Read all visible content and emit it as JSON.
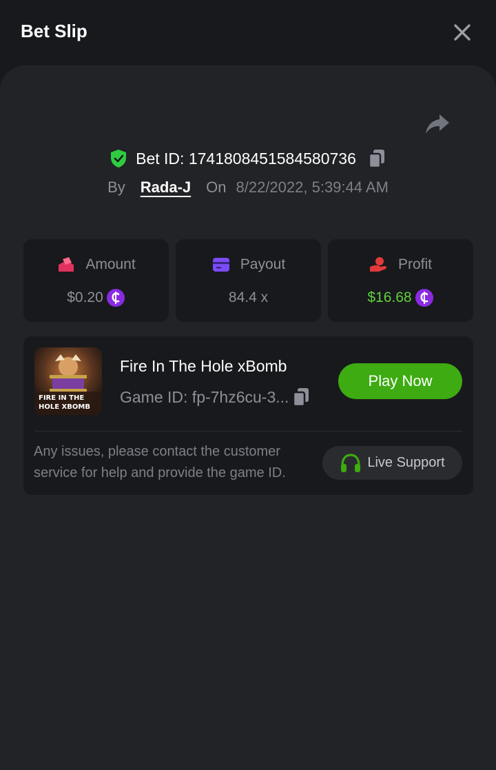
{
  "header": {
    "title": "Bet Slip",
    "close_icon": "close-icon"
  },
  "bet": {
    "id_text": "Bet ID: 1741808451584580736",
    "by_label": "By",
    "user": "Rada-J",
    "on_label": "On",
    "date": "8/22/2022, 5:39:44 AM"
  },
  "stats": [
    {
      "label": "Amount",
      "value": "$0.20",
      "icon": "amount-icon"
    },
    {
      "label": "Payout",
      "value": "84.4 x",
      "icon": "payout-card-icon"
    },
    {
      "label": "Profit",
      "value": "$16.68",
      "icon": "profit-hand-icon"
    }
  ],
  "game": {
    "title": "Fire In The Hole xBomb",
    "id_text": "Game ID: fp-7hz6cu-3...",
    "play_label": "Play Now",
    "thumb_text_line1": "FIRE IN THE",
    "thumb_text_line2": "HOLE XBOMB"
  },
  "support": {
    "text": "Any issues, please contact the customer service for help and provide the game ID.",
    "button_label": "Live Support"
  },
  "colors": {
    "accent_green": "#3dab11",
    "profit_green": "#5fd03b",
    "coin_purple": "#8a2be2",
    "shield_green": "#2ecc40"
  }
}
